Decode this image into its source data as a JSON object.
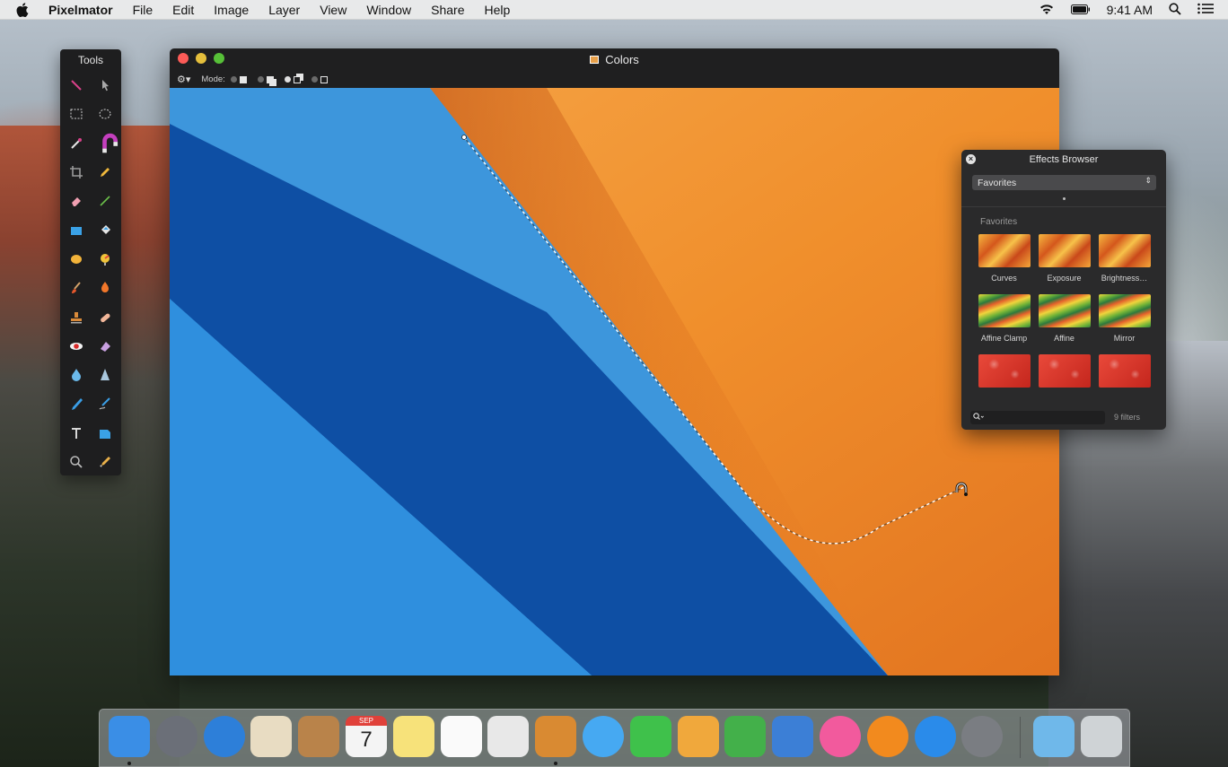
{
  "menubar": {
    "app_name": "Pixelmator",
    "menus": [
      "File",
      "Edit",
      "Image",
      "Layer",
      "View",
      "Window",
      "Share",
      "Help"
    ],
    "clock": "9:41 AM",
    "icons": [
      "wifi-icon",
      "battery-icon",
      "spotlight-icon",
      "notification-center-icon"
    ]
  },
  "tools": {
    "title": "Tools",
    "items": [
      "arrange-layers-tool",
      "move-tool",
      "rectangular-marquee-tool",
      "elliptical-marquee-tool",
      "magic-wand-tool",
      "magnetic-lasso-tool",
      "crop-tool",
      "pencil-tool",
      "eraser-tool",
      "line-tool",
      "rectangle-shape-tool",
      "paint-bucket-tool",
      "ellipse-tool",
      "color-adjust-tool",
      "brush-tool",
      "burn-tool",
      "clone-stamp-tool",
      "heal-tool",
      "red-eye-tool",
      "sponge-tool",
      "blur-tool",
      "sharpen-tool",
      "pen-tool",
      "freeform-pen-tool",
      "type-tool",
      "custom-shape-tool",
      "zoom-tool",
      "eyedropper-tool"
    ]
  },
  "window": {
    "title": "Colors",
    "toolbar": {
      "mode_label": "Mode:"
    }
  },
  "effects": {
    "title": "Effects Browser",
    "category": "Favorites",
    "group_label": "Favorites",
    "items": [
      {
        "label": "Curves",
        "style": "orange"
      },
      {
        "label": "Exposure",
        "style": "orange"
      },
      {
        "label": "Brightness…",
        "style": "orange"
      },
      {
        "label": "Affine Clamp",
        "style": "green"
      },
      {
        "label": "Affine",
        "style": "green"
      },
      {
        "label": "Mirror",
        "style": "green"
      },
      {
        "label": "",
        "style": "red"
      },
      {
        "label": "",
        "style": "red"
      },
      {
        "label": "",
        "style": "red"
      }
    ],
    "filter_count": "9 filters"
  },
  "dock": {
    "apps": [
      {
        "name": "finder",
        "color": "#3a8ee6",
        "running": true
      },
      {
        "name": "launchpad",
        "color": "#6b6f78",
        "running": false
      },
      {
        "name": "safari",
        "color": "#2d7fd9",
        "running": false
      },
      {
        "name": "mail",
        "color": "#e8dcc2",
        "running": false
      },
      {
        "name": "contacts",
        "color": "#b9834a",
        "running": false
      },
      {
        "name": "calendar",
        "color": "#f4f4f4",
        "running": false
      },
      {
        "name": "notes",
        "color": "#f7e27a",
        "running": false
      },
      {
        "name": "reminders",
        "color": "#fafafa",
        "running": false
      },
      {
        "name": "photos",
        "color": "#e8e8e8",
        "running": false
      },
      {
        "name": "pixelmator",
        "color": "#d98a32",
        "running": true
      },
      {
        "name": "messages",
        "color": "#46a9f2",
        "running": false
      },
      {
        "name": "facetime",
        "color": "#3fc14b",
        "running": false
      },
      {
        "name": "pages",
        "color": "#f0a83c",
        "running": false
      },
      {
        "name": "numbers",
        "color": "#43b04a",
        "running": false
      },
      {
        "name": "keynote",
        "color": "#3c7fd6",
        "running": false
      },
      {
        "name": "itunes",
        "color": "#f25a9d",
        "running": false
      },
      {
        "name": "ibooks",
        "color": "#f28a1e",
        "running": false
      },
      {
        "name": "app-store",
        "color": "#2a8bea",
        "running": false
      },
      {
        "name": "system-preferences",
        "color": "#7a7d82",
        "running": false
      },
      {
        "name": "downloads-folder",
        "color": "#6fb8ea",
        "running": false
      },
      {
        "name": "trash",
        "color": "#cfd3d6",
        "running": false
      }
    ],
    "calendar_month": "SEP",
    "calendar_day": "7"
  }
}
